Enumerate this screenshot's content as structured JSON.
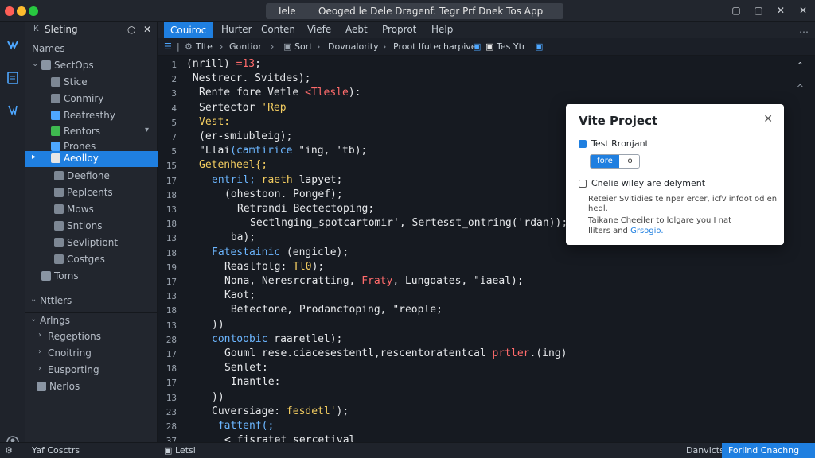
{
  "window": {
    "title_left": "Iele",
    "title_main": "Oeoged le Dele Dragenf: Tegr Prf Dnek Tos App",
    "controls": [
      "▢",
      "▢",
      "✕",
      "✕"
    ]
  },
  "sidebar": {
    "title": "Sleting",
    "header_icons": [
      "○",
      "✕"
    ],
    "items": [
      {
        "label": "Names"
      },
      {
        "label": "SectOps"
      },
      {
        "label": "Stice"
      },
      {
        "label": "Conmiry"
      },
      {
        "label": "Reatresthy"
      },
      {
        "label": "Rentors"
      },
      {
        "label": "Prones"
      },
      {
        "label": "Aeolloy"
      },
      {
        "label": "Deefione"
      },
      {
        "label": "Peplcents"
      },
      {
        "label": "Mows"
      },
      {
        "label": "Sntions"
      },
      {
        "label": "Sevliptiont"
      },
      {
        "label": "Costges"
      },
      {
        "label": "Toms"
      },
      {
        "label": "Nttlers"
      },
      {
        "label": "Arlngs"
      },
      {
        "label": "Regeptions"
      },
      {
        "label": "Cnoitring"
      },
      {
        "label": "Eusporting"
      },
      {
        "label": "Nerlos"
      }
    ],
    "footer": "Yaf Cosctrs"
  },
  "menu": {
    "items": [
      "Couiroc",
      "Hurter",
      "Conten",
      "Viefe",
      "Aebt",
      "Proprot",
      "Help"
    ]
  },
  "breadcrumb": {
    "items": [
      "Tlte",
      "Gontior",
      "Sort",
      "Dovnalority",
      "Proot lfutecharpive",
      "Tes Ytr"
    ]
  },
  "editor": {
    "line_numbers": [
      "1",
      "2",
      "3",
      "4",
      "5",
      "7",
      "5",
      "15",
      "17",
      "18",
      "13",
      "18",
      "13",
      "18",
      "19",
      "17",
      "13",
      "18",
      "13",
      "28",
      "17",
      "18",
      "17",
      "13",
      "23",
      "28",
      "37",
      "18",
      "28"
    ],
    "lines": [
      {
        "indent": 0,
        "segs": [
          {
            "t": "(nrill) ",
            "c": ""
          },
          {
            "t": "=13",
            "c": "red"
          },
          {
            "t": ";",
            "c": ""
          }
        ]
      },
      {
        "indent": 0,
        "segs": [
          {
            "t": " Nestrecr. Svitdes);",
            "c": ""
          }
        ]
      },
      {
        "indent": 1,
        "segs": [
          {
            "t": "Rente fore Vetle ",
            "c": ""
          },
          {
            "t": "<Tlesle",
            "c": "red"
          },
          {
            "t": "):",
            "c": ""
          }
        ]
      },
      {
        "indent": 1,
        "segs": [
          {
            "t": "Sertector ",
            "c": ""
          },
          {
            "t": "'Rep",
            "c": "yel"
          }
        ]
      },
      {
        "indent": 1,
        "segs": [
          {
            "t": "Vest:",
            "c": "yel"
          }
        ]
      },
      {
        "indent": 1,
        "segs": [
          {
            "t": "(er-smiubleig);",
            "c": ""
          }
        ]
      },
      {
        "indent": 1,
        "segs": [
          {
            "t": "\"Llai",
            "c": ""
          },
          {
            "t": "(camtirice",
            "c": "blu"
          },
          {
            "t": " \"ing, 'tb);",
            "c": ""
          }
        ]
      },
      {
        "indent": 1,
        "segs": [
          {
            "t": "Getenheel{;",
            "c": "yel"
          }
        ]
      },
      {
        "indent": 2,
        "segs": [
          {
            "t": "entril; ",
            "c": "blu"
          },
          {
            "t": "raeth",
            "c": "yel"
          },
          {
            "t": " lapyet;",
            "c": ""
          }
        ]
      },
      {
        "indent": 3,
        "segs": [
          {
            "t": "(ohestoon. Pongef);",
            "c": ""
          }
        ]
      },
      {
        "indent": 4,
        "segs": [
          {
            "t": "Retrandi Bectectoping;",
            "c": ""
          }
        ]
      },
      {
        "indent": 5,
        "segs": [
          {
            "t": "Sectlnging_spotcartomir', Sertesst_ontring('rdan));",
            "c": ""
          }
        ]
      },
      {
        "indent": 3,
        "segs": [
          {
            "t": " ba);",
            "c": ""
          }
        ]
      },
      {
        "indent": 2,
        "segs": [
          {
            "t": "Fatestainic ",
            "c": "blu"
          },
          {
            "t": "(engicle);",
            "c": ""
          }
        ]
      },
      {
        "indent": 3,
        "segs": [
          {
            "t": "Reaslfolg: ",
            "c": ""
          },
          {
            "t": "Tl0",
            "c": "yel"
          },
          {
            "t": ");",
            "c": ""
          }
        ]
      },
      {
        "indent": 3,
        "segs": [
          {
            "t": "Nona, Neresrcratting, ",
            "c": ""
          },
          {
            "t": "Fraty",
            "c": "red"
          },
          {
            "t": ", Lungoates, \"iaeal);",
            "c": ""
          }
        ]
      },
      {
        "indent": 3,
        "segs": [
          {
            "t": "Kaot;",
            "c": ""
          }
        ]
      },
      {
        "indent": 3,
        "segs": [
          {
            "t": " Betectone, Prodanctoping, \"reople;",
            "c": ""
          }
        ]
      },
      {
        "indent": 2,
        "segs": [
          {
            "t": "))",
            "c": ""
          }
        ]
      },
      {
        "indent": 2,
        "segs": [
          {
            "t": "contoobic ",
            "c": "blu"
          },
          {
            "t": "raaretlel);",
            "c": ""
          }
        ]
      },
      {
        "indent": 3,
        "segs": [
          {
            "t": "Gouml rese.ciacesestentl,rescentoratentcal ",
            "c": ""
          },
          {
            "t": "prtler",
            "c": "red"
          },
          {
            "t": ".(ing)",
            "c": ""
          }
        ]
      },
      {
        "indent": 3,
        "segs": [
          {
            "t": "Senlet:",
            "c": ""
          }
        ]
      },
      {
        "indent": 3,
        "segs": [
          {
            "t": " Inantle:",
            "c": ""
          }
        ]
      },
      {
        "indent": 2,
        "segs": [
          {
            "t": "))",
            "c": ""
          }
        ]
      },
      {
        "indent": 2,
        "segs": [
          {
            "t": "Cuversiage: ",
            "c": ""
          },
          {
            "t": "fesdetl'",
            "c": "yel"
          },
          {
            "t": ");",
            "c": ""
          }
        ]
      },
      {
        "indent": 2,
        "segs": [
          {
            "t": " fattenf(;",
            "c": "blu"
          }
        ]
      },
      {
        "indent": 3,
        "segs": [
          {
            "t": "< fisratet sercetival",
            "c": ""
          }
        ]
      }
    ]
  },
  "dialog": {
    "title": "Vite Project",
    "close": "✕",
    "option1_label": "Test Rronjant",
    "seg_a": "fore",
    "seg_b": "o",
    "option2_label": "Cnelie wiley are delyment",
    "desc1": "Reteier Svitidies te nper ercer, icfv infdot od en",
    "desc2": "hedl.",
    "desc3": "Taikane Cheeiler to lolgare you I nat",
    "desc4_a": "Iliters and ",
    "desc4_link": "Grsogio."
  },
  "statusbar": {
    "left": "Letsl",
    "right_label": "Danvicts",
    "button": "Forlind Cnachng"
  }
}
